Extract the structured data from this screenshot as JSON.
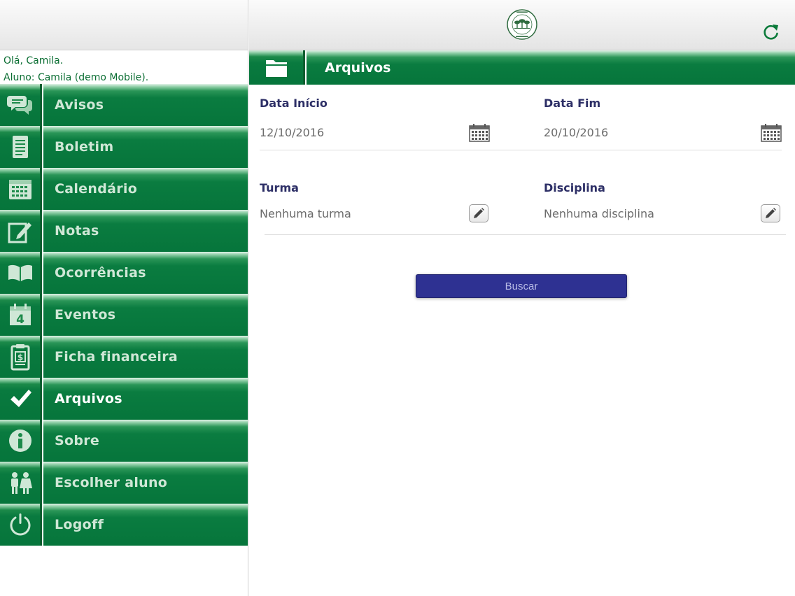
{
  "greeting": {
    "hello": "Olá, Camila.",
    "student": "Aluno: Camila (demo Mobile)."
  },
  "menu": [
    {
      "label": "Avisos",
      "icon": "chat-bubbles-icon",
      "active": false
    },
    {
      "label": "Boletim",
      "icon": "document-icon",
      "active": false
    },
    {
      "label": "Calendário",
      "icon": "calendar-icon",
      "active": false
    },
    {
      "label": "Notas",
      "icon": "note-edit-icon",
      "active": false
    },
    {
      "label": "Ocorrências",
      "icon": "open-book-icon",
      "active": false
    },
    {
      "label": "Eventos",
      "icon": "event-calendar-icon",
      "active": false
    },
    {
      "label": "Ficha financeira",
      "icon": "clipboard-dollar-icon",
      "active": false
    },
    {
      "label": "Arquivos",
      "icon": "checkmark-icon",
      "active": true
    },
    {
      "label": "Sobre",
      "icon": "info-icon",
      "active": false
    },
    {
      "label": "Escolher aluno",
      "icon": "children-icon",
      "active": false
    },
    {
      "label": "Logoff",
      "icon": "power-icon",
      "active": false
    }
  ],
  "page": {
    "title": "Arquivos",
    "title_icon": "folder-icon"
  },
  "form": {
    "start_label": "Data Início",
    "start_value": "12/10/2016",
    "end_label": "Data Fim",
    "end_value": "20/10/2016",
    "class_label": "Turma",
    "class_value": "Nenhuma turma",
    "subject_label": "Disciplina",
    "subject_value": "Nenhuma disciplina",
    "search_button": "Buscar"
  },
  "colors": {
    "brand_green": "#06753b",
    "button_blue": "#2e3192",
    "label_navy": "#2d2f66"
  }
}
